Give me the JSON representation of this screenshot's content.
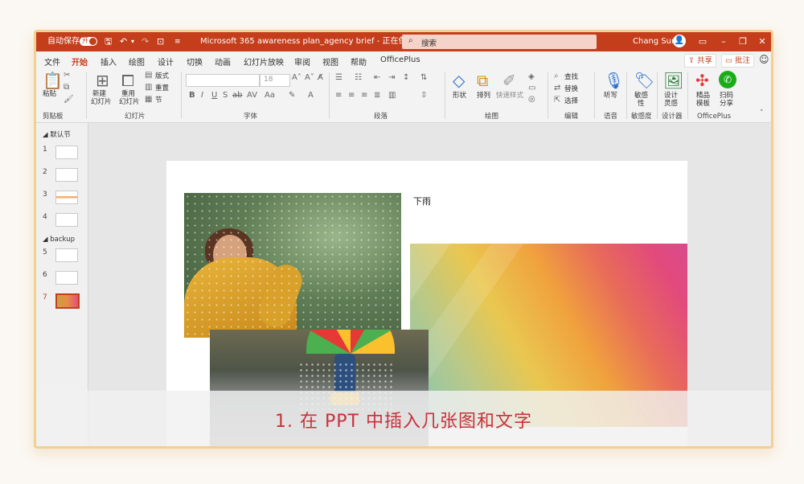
{
  "titlebar": {
    "autosave_label": "自动保存",
    "autosave_state": "开",
    "doc_title": "Microsoft 365 awareness plan_agency brief - 正在保存... ▾",
    "search_placeholder": "搜索",
    "user_name": "Chang Sun",
    "accent_color": "#c43e1c"
  },
  "tabs": [
    "文件",
    "开始",
    "插入",
    "绘图",
    "设计",
    "切换",
    "动画",
    "幻灯片放映",
    "审阅",
    "视图",
    "帮助",
    "OfficePlus"
  ],
  "active_tab": "开始",
  "share_label": "共享",
  "comment_label": "批注",
  "ribbon": {
    "clipboard": {
      "paste": "粘贴",
      "group": "剪贴板"
    },
    "slides": {
      "new_slide_1": "新建",
      "new_slide_2": "幻灯片",
      "reuse_1": "重用",
      "reuse_2": "幻灯片",
      "layout": "版式",
      "reset": "重置",
      "section": "节",
      "group": "幻灯片"
    },
    "font": {
      "size": "18",
      "group": "字体"
    },
    "paragraph": {
      "group": "段落"
    },
    "drawing": {
      "shape": "形状",
      "arrange": "排列",
      "quick_style": "快速样式",
      "group": "绘图"
    },
    "editing": {
      "find": "查找",
      "replace": "替换",
      "select": "选择",
      "group": "编辑"
    },
    "voice": {
      "dictate": "听写",
      "group": "语音"
    },
    "sensitivity": {
      "label_1": "敏感",
      "label_2": "性",
      "group": "敏感度"
    },
    "designer": {
      "label_1": "设计",
      "label_2": "灵感",
      "group": "设计器"
    },
    "officeplus": {
      "templates_1": "精品",
      "templates_2": "模板",
      "scan_1": "扫码",
      "scan_2": "分享",
      "group": "OfficePlus"
    }
  },
  "slide_panel": {
    "section1": "默认节",
    "section2": "backup",
    "numbers": [
      "1",
      "2",
      "3",
      "4",
      "5",
      "6",
      "7"
    ],
    "selected": "7"
  },
  "slide": {
    "title": "下雨"
  },
  "caption": "1. 在 PPT 中插入几张图和文字"
}
